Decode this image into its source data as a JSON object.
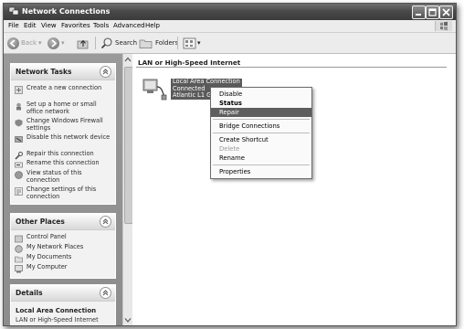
{
  "window": {
    "title": "Network Connections"
  },
  "menu": [
    "File",
    "Edit",
    "View",
    "Favorites",
    "Tools",
    "Advanced",
    "Help"
  ],
  "toolbar": {
    "back": "Back",
    "search": "Search",
    "folders": "Folders"
  },
  "left": {
    "network_tasks": {
      "title": "Network Tasks",
      "items": [
        "Create a new connection",
        "Set up a home or small office network",
        "Change Windows Firewall settings",
        "Disable this network device",
        "Repair this connection",
        "Rename this connection",
        "View status of this connection",
        "Change settings of this connection"
      ]
    },
    "other_places": {
      "title": "Other Places",
      "items": [
        "Control Panel",
        "My Network Places",
        "My Documents",
        "My Computer"
      ]
    },
    "details": {
      "title": "Details",
      "name": "Local Area Connection",
      "type": "LAN or High-Speed Internet"
    }
  },
  "content": {
    "group_header": "LAN or High-Speed Internet",
    "connection": {
      "name": "Local Area Connection",
      "status": "Connected",
      "device": "Atlantic L1 Gi"
    }
  },
  "context_menu": {
    "items": [
      {
        "label": "Disable",
        "state": "normal"
      },
      {
        "label": "Status",
        "state": "bold"
      },
      {
        "label": "Repair",
        "state": "highlighted"
      },
      {
        "label": "Bridge Connections",
        "state": "normal"
      },
      {
        "label": "Create Shortcut",
        "state": "normal"
      },
      {
        "label": "Delete",
        "state": "disabled"
      },
      {
        "label": "Rename",
        "state": "normal"
      },
      {
        "label": "Properties",
        "state": "normal"
      }
    ]
  }
}
